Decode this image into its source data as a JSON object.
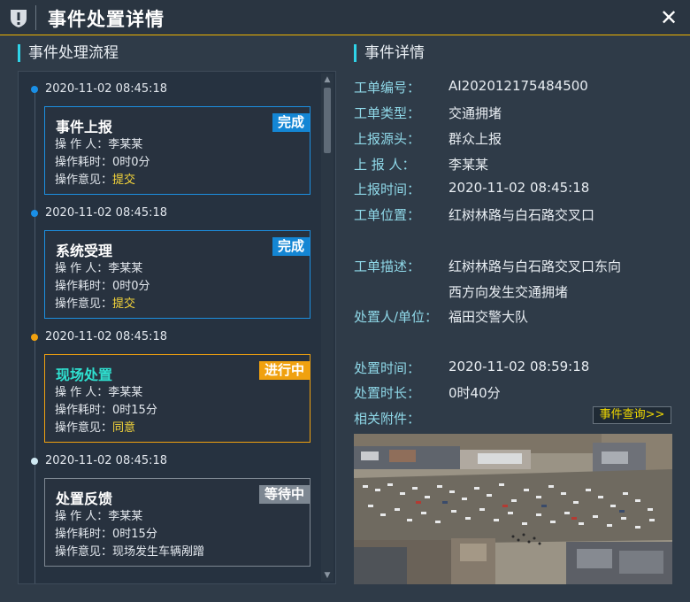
{
  "header": {
    "title": "事件处置详情",
    "warn_icon": "warning-shield-icon",
    "close_label": "✕"
  },
  "flow": {
    "title": "事件处理流程",
    "labels": {
      "operator": "操 作 人：",
      "duration": "操作耗时：",
      "opinion": "操作意见："
    },
    "steps": [
      {
        "time": "2020-11-02 08:45:18",
        "title": "事件上报",
        "status": "完成",
        "status_color": "#1486d4",
        "operator": "李某某",
        "duration": "0时0分",
        "opinion": "提交"
      },
      {
        "time": "2020-11-02 08:45:18",
        "title": "系统受理",
        "status": "完成",
        "status_color": "#1486d4",
        "operator": "李某某",
        "duration": "0时0分",
        "opinion": "提交"
      },
      {
        "time": "2020-11-02 08:45:18",
        "title": "现场处置",
        "status": "进行中",
        "status_color": "#f0a10f",
        "operator": "李某某",
        "duration": "0时15分",
        "opinion": "同意"
      },
      {
        "time": "2020-11-02 08:45:18",
        "title": "处置反馈",
        "status": "等待中",
        "status_color": "#7d8792",
        "operator": "李某某",
        "duration": "0时15分",
        "opinion": "现场发生车辆剐蹭"
      }
    ]
  },
  "detail": {
    "title": "事件详情",
    "fields": {
      "order_no_label": "工单编号：",
      "order_no": "AI202012175484500",
      "type_label": "工单类型：",
      "type": "交通拥堵",
      "source_label": "上报源头：",
      "source": "群众上报",
      "reporter_label": "上 报 人：",
      "reporter": "李某某",
      "report_time_label": "上报时间：",
      "report_time": "2020-11-02 08:45:18",
      "location_label": "工单位置：",
      "location": "红树林路与白石路交叉口",
      "desc_label": "工单描述：",
      "desc_line1": "红树林路与白石路交叉口东向",
      "desc_line2": "西方向发生交通拥堵",
      "handler_label": "处置人/单位：",
      "handler": "福田交警大队",
      "handle_time_label": "处置时间：",
      "handle_time": "2020-11-02 08:59:18",
      "handle_duration_label": "处置时长：",
      "handle_duration": "0时40分",
      "attachment_label": "相关附件："
    },
    "query_button": "事件查询>>"
  }
}
